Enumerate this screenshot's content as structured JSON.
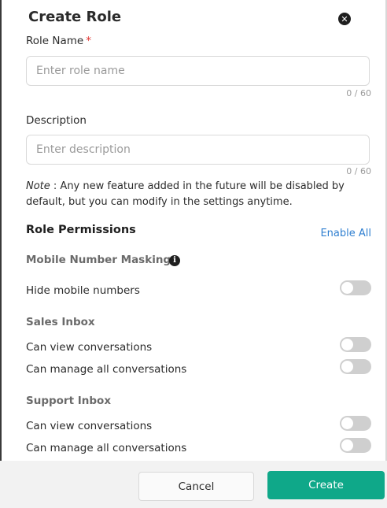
{
  "modal": {
    "title": "Create Role",
    "close_icon": "close-icon"
  },
  "form": {
    "role_name": {
      "label": "Role Name",
      "required_mark": "*",
      "placeholder": "Enter role name",
      "value": "",
      "counter": "0 / 60"
    },
    "description": {
      "label": "Description",
      "placeholder": "Enter description",
      "value": "",
      "counter": "0 / 60"
    },
    "note": {
      "prefix": "Note",
      "text": " : Any new feature added in the future will be disabled by default, but you can modify in the settings anytime."
    }
  },
  "permissions": {
    "title": "Role Permissions",
    "enable_all": "Enable All",
    "sections": [
      {
        "name": "Mobile Number Masking",
        "info_icon": "info-icon",
        "items": [
          {
            "label": "Hide mobile numbers",
            "enabled": false
          }
        ]
      },
      {
        "name": "Sales Inbox",
        "items": [
          {
            "label": "Can view conversations",
            "enabled": false
          },
          {
            "label": "Can manage all conversations",
            "enabled": false
          }
        ]
      },
      {
        "name": "Support Inbox",
        "items": [
          {
            "label": "Can view conversations",
            "enabled": false
          },
          {
            "label": "Can manage all conversations",
            "enabled": false
          }
        ]
      }
    ]
  },
  "footer": {
    "cancel_label": "Cancel",
    "create_label": "Create"
  },
  "colors": {
    "primary": "#0fa889",
    "link": "#2f7fd0",
    "required": "#e0332f",
    "toggle_off": "#cfcfcf"
  }
}
